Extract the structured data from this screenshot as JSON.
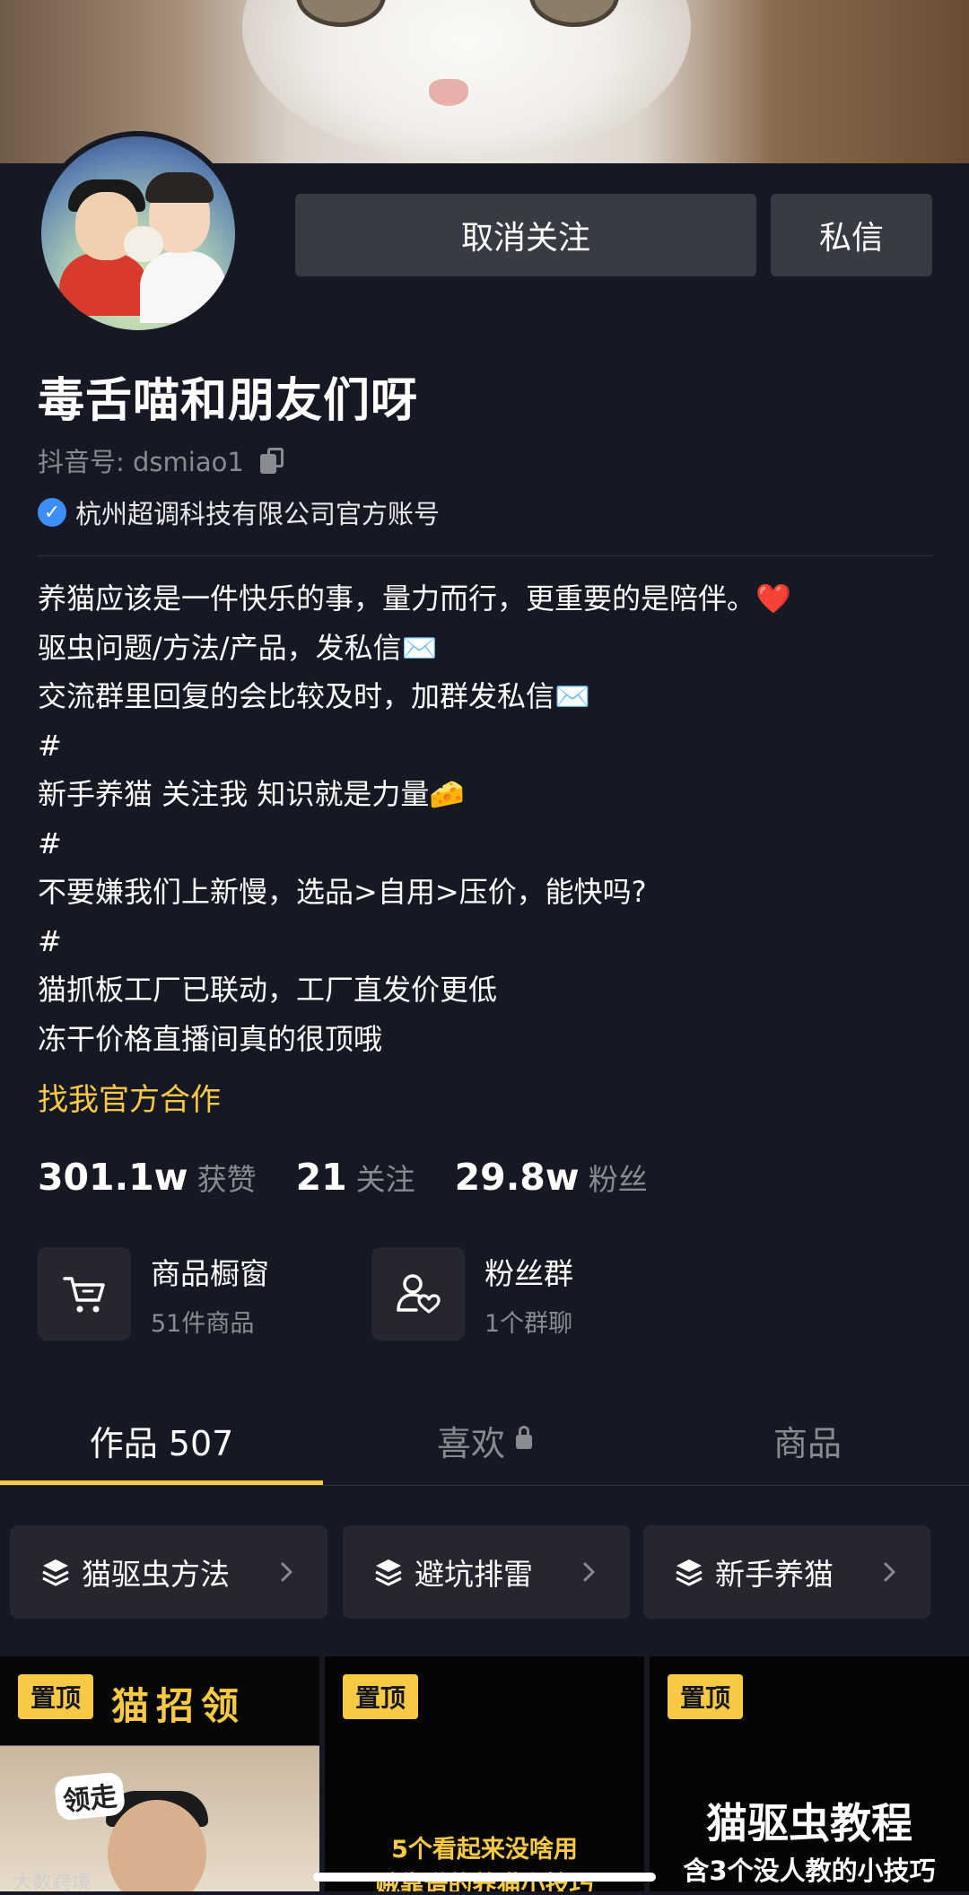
{
  "profile": {
    "name": "毒舌喵和朋友们呀",
    "douyin_id": "抖音号: dsmiao1",
    "verified": "杭州超调科技有限公司官方账号",
    "bio_lines": [
      "养猫应该是一件快乐的事，量力而行，更重要的是陪伴。❤️",
      "驱虫问题/方法/产品，发私信✉️",
      "交流群里回复的会比较及时，加群发私信✉️",
      "#",
      "新手养猫 关注我 知识就是力量🧀",
      "#",
      "不要嫌我们上新慢，选品>自用>压价，能快吗?",
      "#",
      "猫抓板工厂已联动，工厂直发价更低",
      "冻干价格直播间真的很顶哦"
    ],
    "cooperation_link": "找我官方合作"
  },
  "actions": {
    "unfollow": "取消关注",
    "message": "私信"
  },
  "stats": {
    "likes_value": "301.1w",
    "likes_label": "获赞",
    "following_value": "21",
    "following_label": "关注",
    "fans_value": "29.8w",
    "fans_label": "粉丝"
  },
  "cards": {
    "shop_title": "商品橱窗",
    "shop_sub": "51件商品",
    "fans_title": "粉丝群",
    "fans_sub": "1个群聊"
  },
  "tabs": {
    "works": "作品 507",
    "likes": "喜欢",
    "goods": "商品"
  },
  "collections": [
    "猫驱虫方法",
    "避坑排雷",
    "新手养猫"
  ],
  "videos": {
    "pin_label": "置顶",
    "v1_title": "猫招领",
    "v1_bubble": "领走",
    "v2_text_1": "5个看起来没啥用",
    "v2_text_2": "贼靠谱的养猫小技巧",
    "v3_title": "猫驱虫教程",
    "v3_sub": "含3个没人教的小技巧"
  },
  "watermark": "大数跨境",
  "colors": {
    "background": "#161823",
    "accent": "#f7c945",
    "button": "#393b44",
    "muted_text": "#8a8b91",
    "verified_blue": "#3e8ef7"
  }
}
